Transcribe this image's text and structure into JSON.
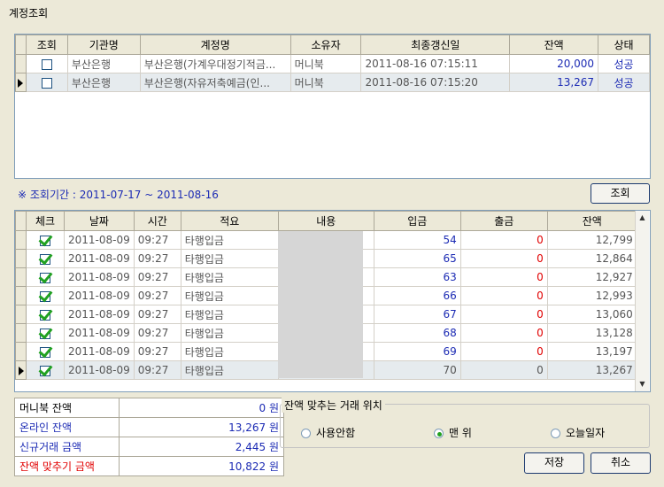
{
  "window": {
    "title": "계정조회"
  },
  "accounts": {
    "headers": [
      "조회",
      "기관명",
      "계정명",
      "소유자",
      "최종갱신일",
      "잔액",
      "상태"
    ],
    "rows": [
      {
        "bank": "부산은행",
        "name": "부산은행(가계우대정기적금...",
        "owner": "머니북",
        "updated": "2011-08-16 07:15:11",
        "balance": "20,000",
        "status": "성공"
      },
      {
        "bank": "부산은행",
        "name": "부산은행(자유저축예금(인...",
        "owner": "머니북",
        "updated": "2011-08-16 07:15:20",
        "balance": "13,267",
        "status": "성공"
      }
    ]
  },
  "period": {
    "text": "※ 조회기간 : 2011-07-17 ~ 2011-08-16"
  },
  "buttons": {
    "query": "조회",
    "save": "저장",
    "cancel": "취소"
  },
  "transactions": {
    "headers": [
      "체크",
      "날짜",
      "시간",
      "적요",
      "내용",
      "입금",
      "출금",
      "잔액"
    ],
    "rows": [
      {
        "date": "2011-08-09",
        "time": "09:27",
        "memo": "타행입금",
        "content": "",
        "deposit": "54",
        "withdraw": "0",
        "balance": "12,799"
      },
      {
        "date": "2011-08-09",
        "time": "09:27",
        "memo": "타행입금",
        "content": "",
        "deposit": "65",
        "withdraw": "0",
        "balance": "12,864"
      },
      {
        "date": "2011-08-09",
        "time": "09:27",
        "memo": "타행입금",
        "content": "",
        "deposit": "63",
        "withdraw": "0",
        "balance": "12,927"
      },
      {
        "date": "2011-08-09",
        "time": "09:27",
        "memo": "타행입금",
        "content": "",
        "deposit": "66",
        "withdraw": "0",
        "balance": "12,993"
      },
      {
        "date": "2011-08-09",
        "time": "09:27",
        "memo": "타행입금",
        "content": "",
        "deposit": "67",
        "withdraw": "0",
        "balance": "13,060"
      },
      {
        "date": "2011-08-09",
        "time": "09:27",
        "memo": "타행입금",
        "content": "",
        "deposit": "68",
        "withdraw": "0",
        "balance": "13,128"
      },
      {
        "date": "2011-08-09",
        "time": "09:27",
        "memo": "타행입금",
        "content": "",
        "deposit": "69",
        "withdraw": "0",
        "balance": "13,197"
      },
      {
        "date": "2011-08-09",
        "time": "09:27",
        "memo": "타행입금",
        "content": "",
        "deposit": "70",
        "withdraw": "0",
        "balance": "13,267"
      }
    ]
  },
  "summary": [
    {
      "label": "머니북 잔액",
      "value": "0 원"
    },
    {
      "label": "온라인 잔액",
      "value": "13,267 원"
    },
    {
      "label": "신규거래 금액",
      "value": "2,445 원"
    },
    {
      "label": "잔액 맞추기 금액",
      "value": "10,822 원"
    }
  ],
  "position": {
    "title": "잔액 맞추는 거래 위치",
    "options": [
      "사용안함",
      "맨 위",
      "오늘일자"
    ],
    "selected": "맨 위"
  },
  "colors": {
    "background": "#ece9d8",
    "blue_text": "#1c2bb4",
    "red_text": "#e10000",
    "selected_row": "#e6ebee",
    "check_green": "#21a121"
  },
  "icons": {
    "row_pointer": "right-triangle-icon",
    "checkbox": "checkbox-icon",
    "scroll_up": "up-arrow-icon",
    "scroll_down": "down-arrow-icon"
  }
}
